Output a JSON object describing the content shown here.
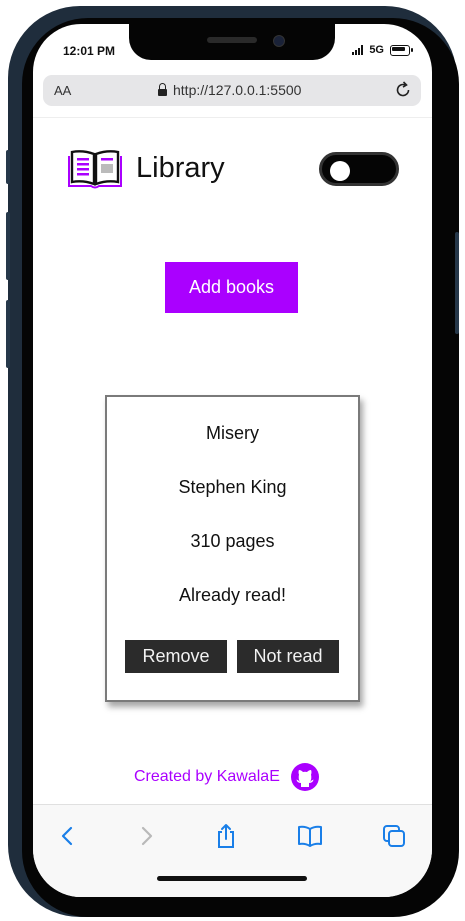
{
  "status_bar": {
    "time": "12:01 PM",
    "network": "5G"
  },
  "browser": {
    "text_size_label": "AA",
    "url": "http://127.0.0.1:5500"
  },
  "header": {
    "title": "Library"
  },
  "actions": {
    "add_books_label": "Add books"
  },
  "books": [
    {
      "title": "Misery",
      "author": "Stephen King",
      "pages": "310 pages",
      "status": "Already read!",
      "remove_label": "Remove",
      "toggle_label": "Not read"
    }
  ],
  "footer": {
    "credit": "Created by KawalaE"
  },
  "colors": {
    "accent": "#aa00ff",
    "card_button": "#2b2b2b",
    "toggle": "#050505"
  },
  "icons": [
    "library-book-icon",
    "github-icon",
    "back-icon",
    "forward-icon",
    "share-icon",
    "bookmarks-icon",
    "tabs-icon",
    "reload-icon",
    "lock-icon"
  ]
}
